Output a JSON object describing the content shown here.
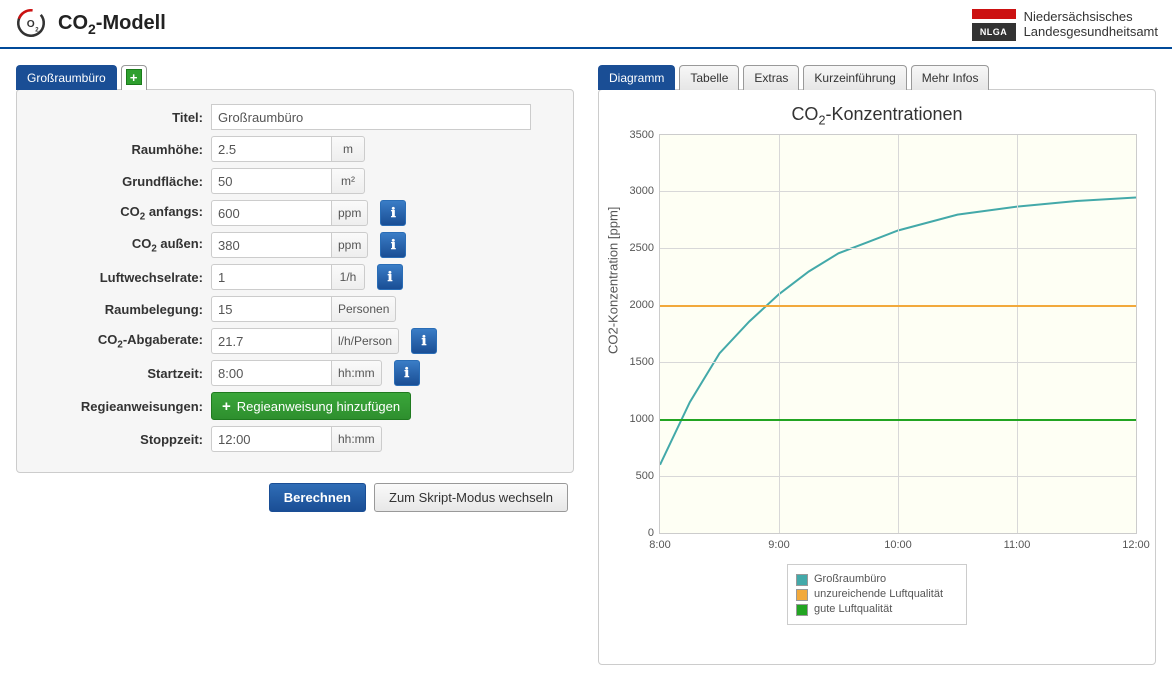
{
  "header": {
    "title_html": "CO₂-Modell",
    "org_abbr": "NLGA",
    "org_line1": "Niedersächsisches",
    "org_line2": "Landesgesundheitsamt"
  },
  "left_tabs": {
    "active": "Großraumbüro"
  },
  "form": {
    "labels": {
      "titel": "Titel:",
      "raumhoehe": "Raumhöhe:",
      "grundflaeche": "Grundfläche:",
      "co2_anfangs": "CO₂ anfangs:",
      "co2_aussen": "CO₂ außen:",
      "luftwechsel": "Luftwechselrate:",
      "raumbelegung": "Raumbelegung:",
      "co2_abgabe": "CO₂-Abgaberate:",
      "startzeit": "Startzeit:",
      "regie": "Regieanweisungen:",
      "stoppzeit": "Stoppzeit:"
    },
    "values": {
      "titel": "Großraumbüro",
      "raumhoehe": "2.5",
      "grundflaeche": "50",
      "co2_anfangs": "600",
      "co2_aussen": "380",
      "luftwechsel": "1",
      "raumbelegung": "15",
      "co2_abgabe": "21.7",
      "startzeit": "8:00",
      "stoppzeit": "12:00"
    },
    "units": {
      "m": "m",
      "m2": "m²",
      "ppm": "ppm",
      "perh": "1/h",
      "personen": "Personen",
      "lhperson": "l/h/Person",
      "hhmm": "hh:mm"
    },
    "add_regie": "Regieanweisung hinzufügen"
  },
  "actions": {
    "berechnen": "Berechnen",
    "script_mode": "Zum Skript-Modus wechseln"
  },
  "right_tabs": {
    "diagramm": "Diagramm",
    "tabelle": "Tabelle",
    "extras": "Extras",
    "kurz": "Kurzeinführung",
    "mehr": "Mehr Infos"
  },
  "chart": {
    "title": "CO₂-Konzentrationen",
    "ylabel": "CO2-Konzentration [ppm]",
    "legend": {
      "series": "Großraumbüro",
      "bad": "unzureichende Luftqualität",
      "good": "gute Luftqualität"
    }
  },
  "chart_data": {
    "type": "line",
    "title": "CO₂-Konzentrationen",
    "xlabel": "",
    "ylabel": "CO2-Konzentration [ppm]",
    "x_ticks": [
      "8:00",
      "9:00",
      "10:00",
      "11:00",
      "12:00"
    ],
    "y_ticks": [
      0,
      500,
      1000,
      1500,
      2000,
      2500,
      3000,
      3500
    ],
    "ylim": [
      0,
      3500
    ],
    "xlim_hours": [
      8,
      12
    ],
    "series": [
      {
        "name": "Großraumbüro",
        "color": "#43a9a9",
        "x_hours": [
          8.0,
          8.25,
          8.5,
          8.75,
          9.0,
          9.25,
          9.5,
          9.75,
          10.0,
          10.5,
          11.0,
          11.5,
          12.0
        ],
        "y": [
          600,
          1150,
          1580,
          1860,
          2100,
          2300,
          2460,
          2560,
          2660,
          2800,
          2870,
          2920,
          2950
        ]
      },
      {
        "name": "unzureichende Luftqualität",
        "color": "#f2a93b",
        "type": "hline",
        "y": 2000
      },
      {
        "name": "gute Luftqualität",
        "color": "#22a522",
        "type": "hline",
        "y": 1000
      }
    ]
  }
}
